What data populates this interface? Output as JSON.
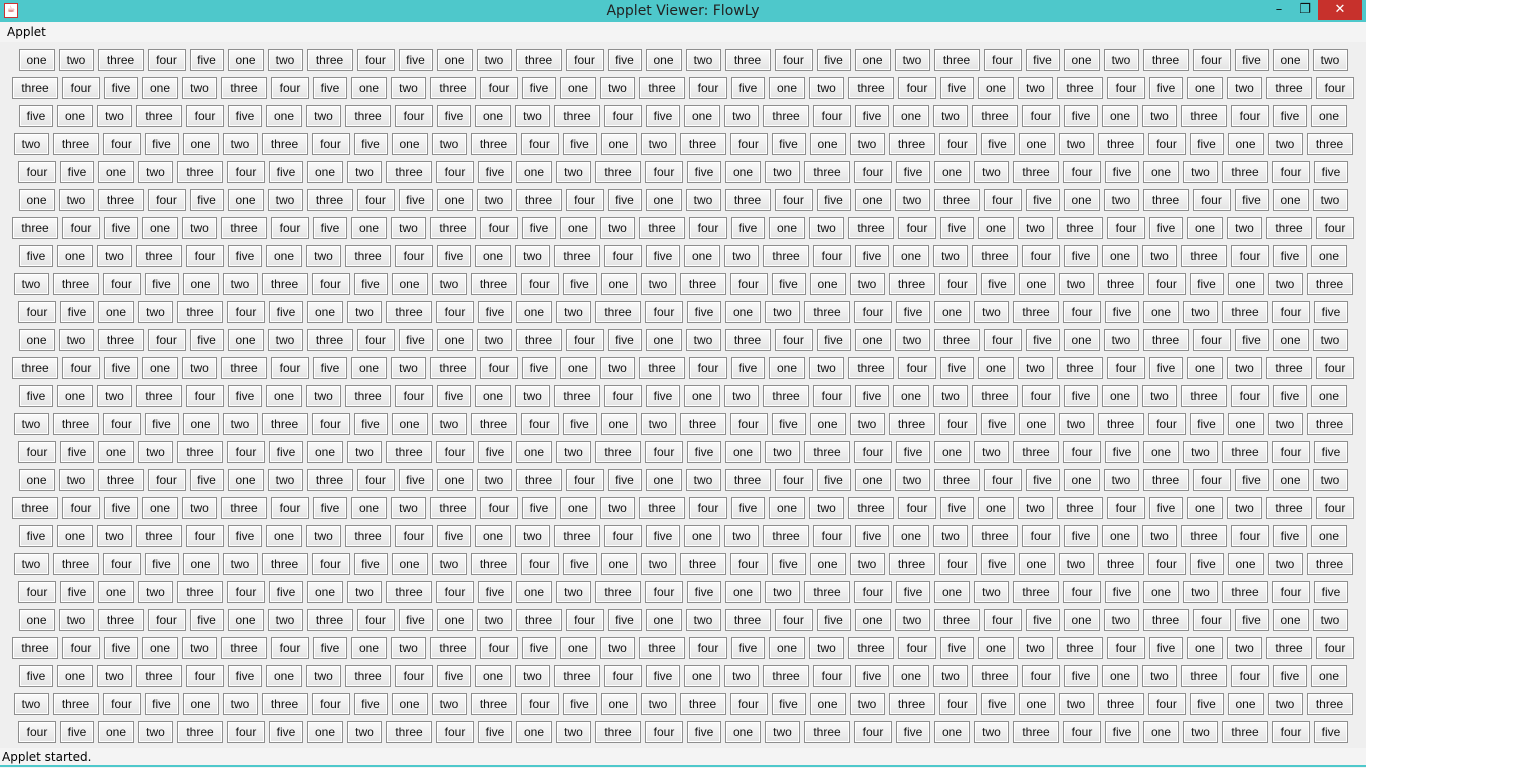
{
  "window": {
    "title": "Applet Viewer: FlowLy",
    "icon": "java-icon",
    "controls": {
      "minimize": "–",
      "maximize": "❐",
      "close": "✕"
    }
  },
  "menubar": {
    "items": [
      "Applet"
    ]
  },
  "button_labels": [
    "one",
    "two",
    "three",
    "four",
    "five"
  ],
  "grid": {
    "rows": 25,
    "first_row_button_count": 33
  },
  "status": {
    "text": "Applet started."
  },
  "colors": {
    "titlebar": "#4ec8cb",
    "close": "#c7312c"
  }
}
